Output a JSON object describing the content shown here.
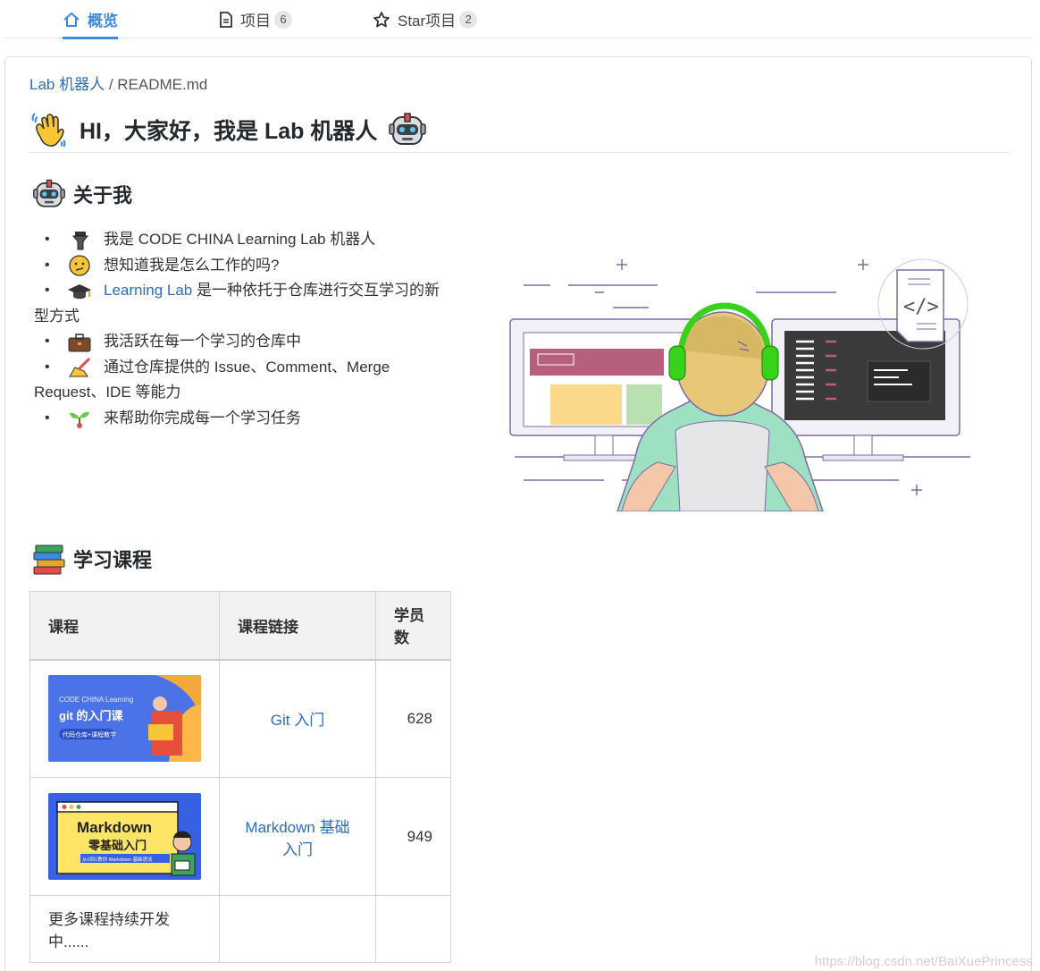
{
  "tabs": [
    {
      "label": "概览",
      "icon": "home-icon",
      "active": true
    },
    {
      "label": "项目",
      "icon": "file-icon",
      "count": "6"
    },
    {
      "label": "Star项目",
      "icon": "star-icon",
      "count": "2"
    }
  ],
  "breadcrumb": {
    "repo": "Lab 机器人",
    "separator": " / ",
    "file": "README.md"
  },
  "readme": {
    "title": "HI，大家好，我是 Lab 机器人",
    "about_heading": "关于我",
    "about_items": [
      {
        "icon": "flashlight-icon",
        "text": "我是 CODE CHINA Learning Lab 机器人"
      },
      {
        "icon": "thinking-face-icon",
        "text": "想知道我是怎么工作的吗?"
      },
      {
        "icon": "graduation-cap-icon",
        "link": "Learning Lab",
        "text": " 是一种依托于仓库进行交互学习的新型方式"
      },
      {
        "icon": "briefcase-icon",
        "text": "我活跃在每一个学习的仓库中"
      },
      {
        "icon": "writing-hand-icon",
        "text": "通过仓库提供的 Issue、Comment、Merge Request、IDE 等能力"
      },
      {
        "icon": "seedling-icon",
        "text": "来帮助你完成每一个学习任务"
      }
    ],
    "courses_heading": "学习课程",
    "table": {
      "headers": [
        "课程",
        "课程链接",
        "学员数"
      ],
      "rows": [
        {
          "thumb_title": "git 的入门课",
          "thumb_brand": "CODE CHINA Learning",
          "thumb_tag": "代码仓库+课程教学",
          "link": "Git 入门",
          "students": "628"
        },
        {
          "thumb_title": "Markdown",
          "thumb_subtitle": "零基础入门",
          "thumb_tag": "从0到1教你 Markdown 基础语法",
          "link": "Markdown 基础入门",
          "students": "949"
        },
        {
          "text": "更多课程持续开发中......",
          "link": "",
          "students": ""
        }
      ]
    }
  },
  "watermark": "https://blog.csdn.net/BaiXuePrincess",
  "colors": {
    "accent": "#3b8be0",
    "link": "#2a6ebd"
  }
}
